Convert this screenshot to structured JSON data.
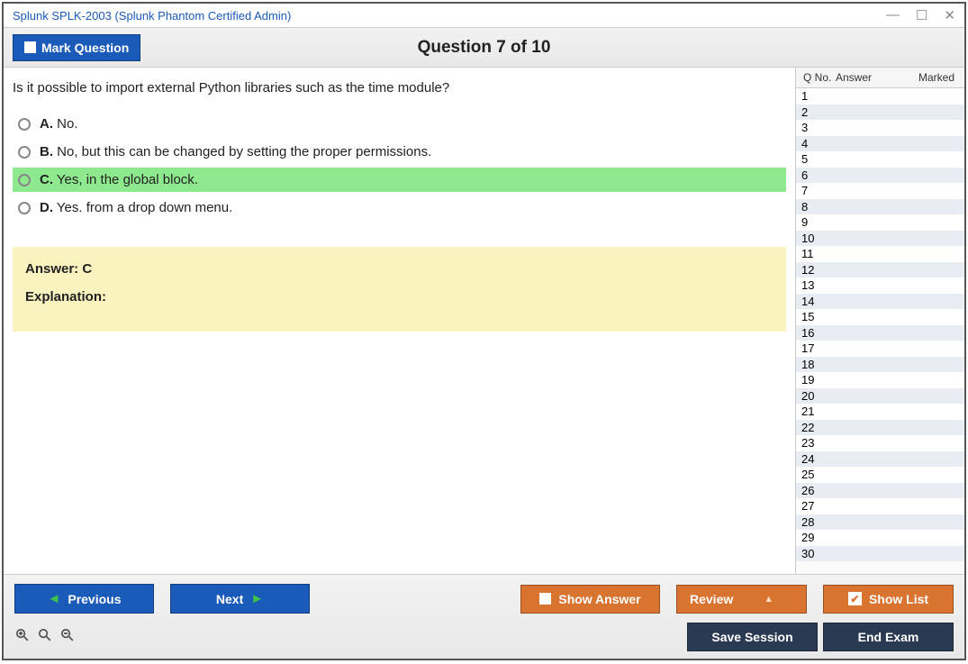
{
  "window": {
    "title": "Splunk SPLK-2003 (Splunk Phantom Certified Admin)"
  },
  "header": {
    "mark_label": "Mark Question",
    "question_title": "Question 7 of 10"
  },
  "question": {
    "text": "Is it possible to import external Python libraries such as the time module?",
    "options": [
      {
        "letter": "A.",
        "text": "No.",
        "highlight": false
      },
      {
        "letter": "B.",
        "text": "No, but this can be changed by setting the proper permissions.",
        "highlight": false
      },
      {
        "letter": "C.",
        "text": "Yes, in the global block.",
        "highlight": true
      },
      {
        "letter": "D.",
        "text": "Yes. from a drop down menu.",
        "highlight": false
      }
    ],
    "answer_label": "Answer: C",
    "explanation_label": "Explanation:"
  },
  "sidebar": {
    "cols": {
      "q": "Q No.",
      "a": "Answer",
      "m": "Marked"
    },
    "rows": [
      "1",
      "2",
      "3",
      "4",
      "5",
      "6",
      "7",
      "8",
      "9",
      "10",
      "11",
      "12",
      "13",
      "14",
      "15",
      "16",
      "17",
      "18",
      "19",
      "20",
      "21",
      "22",
      "23",
      "24",
      "25",
      "26",
      "27",
      "28",
      "29",
      "30"
    ]
  },
  "footer": {
    "previous": "Previous",
    "next": "Next",
    "show_answer": "Show Answer",
    "review": "Review",
    "show_list": "Show List",
    "save_session": "Save Session",
    "end_exam": "End Exam"
  }
}
